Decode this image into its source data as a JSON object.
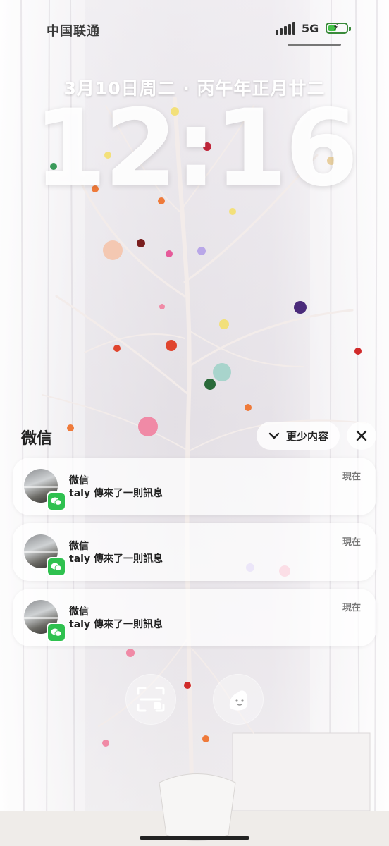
{
  "status_bar": {
    "carrier": "中国联通",
    "network": "5G",
    "battery_level_percent": 45,
    "battery_charging": true
  },
  "lock_screen": {
    "date": "3月10日周二 · 丙午年正月廿二",
    "time": "12:16"
  },
  "notification_group": {
    "app_name": "微信",
    "show_less_label": "更少内容",
    "notifications": [
      {
        "title": "微信",
        "body": "taly 傳來了一則訊息",
        "time": "現在"
      },
      {
        "title": "微信",
        "body": "taly 傳來了一則訊息",
        "time": "現在"
      },
      {
        "title": "微信",
        "body": "taly 傳來了一則訊息",
        "time": "現在"
      }
    ]
  },
  "quick_actions": [
    {
      "icon": "scan-translate-icon"
    },
    {
      "icon": "sticker-icon"
    }
  ],
  "colors": {
    "wechat_green": "#2fc14f",
    "battery_green": "#43c047"
  }
}
